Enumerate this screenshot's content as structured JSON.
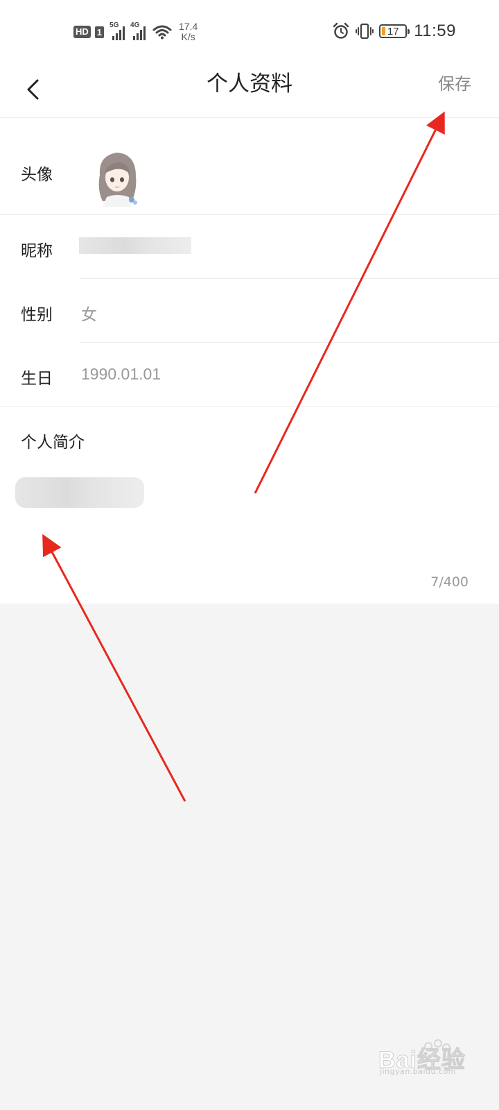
{
  "status_bar": {
    "hd_badge": "HD",
    "sim_slot": "1",
    "signal_1_tag": "5G",
    "signal_2_tag": "4G",
    "net_speed_value": "17.4",
    "net_speed_unit": "K/s",
    "battery_level": "17",
    "time": "11:59",
    "icons": [
      "wifi-icon",
      "alarm-icon",
      "vibrate-icon",
      "battery-icon"
    ]
  },
  "header": {
    "back_icon": "chevron-left-icon",
    "title": "个人资料",
    "save_label": "保存"
  },
  "profile": {
    "avatar_label": "头像",
    "nickname_label": "昵称",
    "gender_label": "性别",
    "gender_value": "女",
    "birthday_label": "生日",
    "birthday_value": "1990.01.01",
    "bio_label": "个人简介",
    "bio_counter": "7/400"
  },
  "watermark": {
    "text": "Bai经验",
    "sub": "jingyan.baidu.com"
  },
  "colors": {
    "annotation_arrow": "#e8281e",
    "battery_fill": "#f0a31f",
    "page_bg": "#f4f4f4"
  }
}
